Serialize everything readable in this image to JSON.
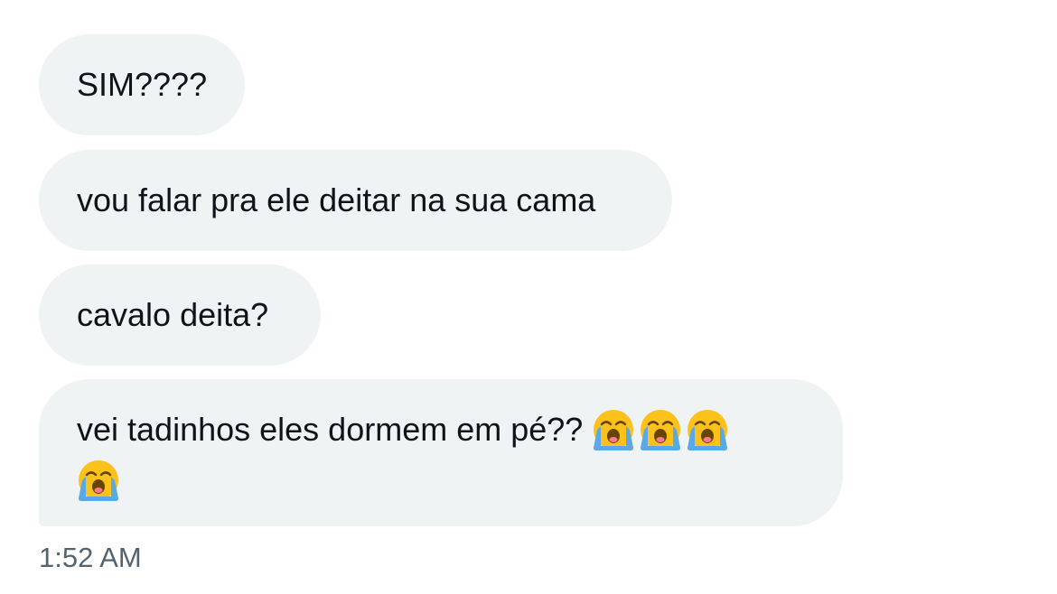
{
  "messages": [
    {
      "text": "SIM????"
    },
    {
      "text": "vou falar pra ele deitar na sua cama"
    },
    {
      "text": "cavalo deita?"
    },
    {
      "text": "vei tadinhos eles dormem em pé??",
      "emojis": [
        "loudly-crying-face-icon",
        "loudly-crying-face-icon",
        "loudly-crying-face-icon",
        "loudly-crying-face-icon"
      ]
    }
  ],
  "timestamp": "1:52 AM",
  "colors": {
    "bubble_bg": "#eff3f4",
    "text": "#0f1419",
    "timestamp": "#536471",
    "emoji_face": "#fcc21b",
    "emoji_tears": "#5aa9e6"
  }
}
